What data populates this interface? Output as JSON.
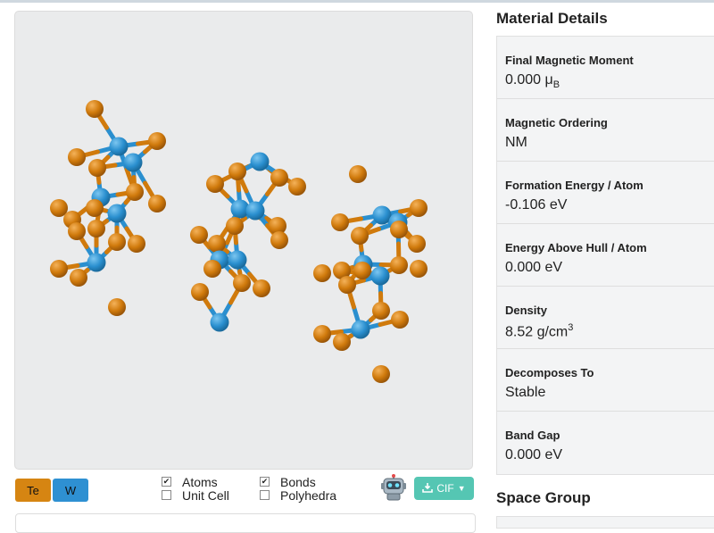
{
  "structure_viewer": {
    "colors": {
      "te": "#d07a0c",
      "w": "#2a8fcf",
      "background": "#eaebec"
    }
  },
  "legend": [
    {
      "label": "Te",
      "color": "#d68512"
    },
    {
      "label": "W",
      "color": "#2e90d2"
    }
  ],
  "controls": {
    "atoms": {
      "label": "Atoms",
      "checked": true
    },
    "unit_cell": {
      "label": "Unit Cell",
      "checked": false
    },
    "bonds": {
      "label": "Bonds",
      "checked": true
    },
    "polyhedra": {
      "label": "Polyhedra",
      "checked": false
    }
  },
  "export": {
    "label": "CIF",
    "icon": "download-icon",
    "caret": "caret-down-icon",
    "color": "#55c6b3"
  },
  "robot_icon": "robot-icon",
  "material_details": {
    "title": "Material Details",
    "final_magnetic_moment": {
      "label": "Final Magnetic Moment",
      "value": "0.000 μ",
      "unit_sub": "B"
    },
    "magnetic_ordering": {
      "label": "Magnetic Ordering",
      "value": "NM"
    },
    "formation_energy": {
      "label": "Formation Energy / Atom",
      "value": "-0.106 eV"
    },
    "energy_above_hull": {
      "label": "Energy Above Hull / Atom",
      "value": "0.000 eV"
    },
    "density": {
      "label": "Density",
      "value": "8.52 g/cm",
      "unit_sup": "3"
    },
    "decomposes_to": {
      "label": "Decomposes To",
      "value": "Stable"
    },
    "band_gap": {
      "label": "Band Gap",
      "value": "0.000 eV"
    }
  },
  "space_group": {
    "title": "Space Group"
  }
}
